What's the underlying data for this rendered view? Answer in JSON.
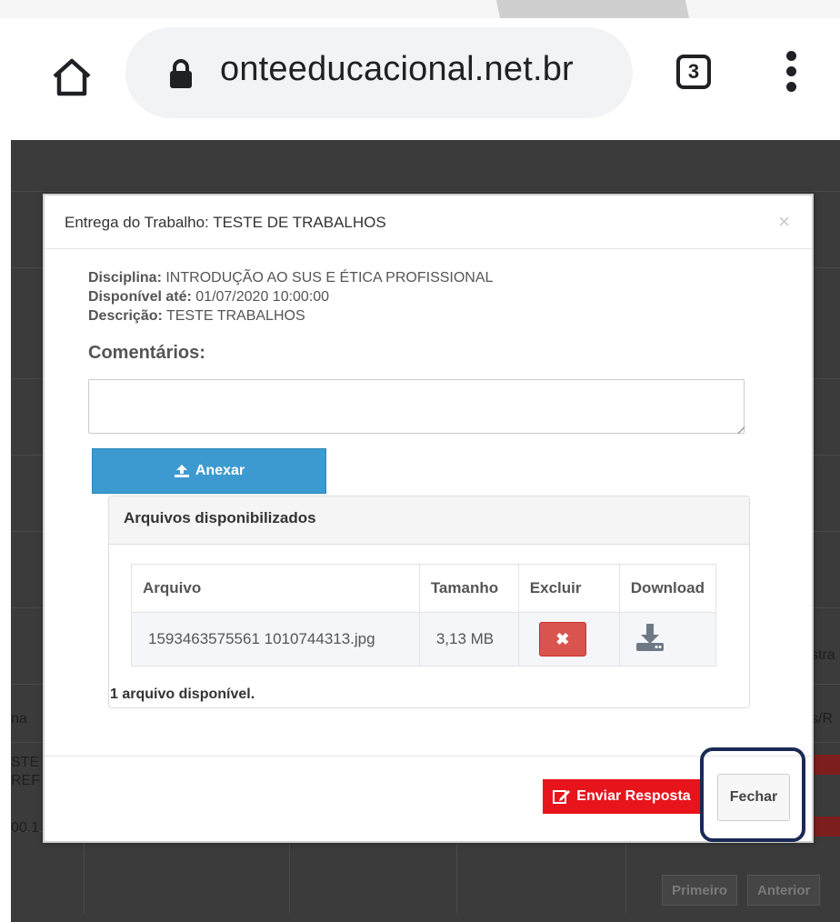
{
  "browser": {
    "url": "onteeducacional.net.br",
    "tab_count": "3",
    "icons": [
      "home-icon",
      "lock-icon",
      "tab-switcher-icon",
      "menu-icon"
    ]
  },
  "background": {
    "fragments": [
      "stra",
      "na",
      "s/R",
      "STE",
      "REF",
      "00.1"
    ],
    "pager": [
      "Primeiro",
      "Anterior"
    ]
  },
  "modal": {
    "title": "Entrega do Trabalho: TESTE DE TRABALHOS",
    "close_label": "×",
    "disciplina_label": "Disciplina:",
    "disciplina_value": "INTRODUÇÃO AO SUS E ÉTICA PROFISSIONAL",
    "disponivel_label": "Disponível até:",
    "disponivel_value": "01/07/2020 10:00:00",
    "descricao_label": "Descrição:",
    "descricao_value": "TESTE TRABALHOS",
    "comments_label": "Comentários:",
    "comments_value": "",
    "attach_label": "Anexar",
    "files_panel": {
      "title": "Arquivos disponibilizados",
      "columns": [
        "Arquivo",
        "Tamanho",
        "Excluir",
        "Download"
      ],
      "rows": [
        {
          "file": "1593463575561 1010744313.jpg",
          "size": "3,13 MB"
        }
      ],
      "count_text": "1 arquivo disponível."
    },
    "send_label": "Enviar Resposta",
    "close_button_label": "Fechar"
  },
  "colors": {
    "attach_button": "#3d9ad0",
    "delete_button": "#d9534f",
    "send_button": "#e8141c",
    "highlight_border": "#1a2a55"
  }
}
